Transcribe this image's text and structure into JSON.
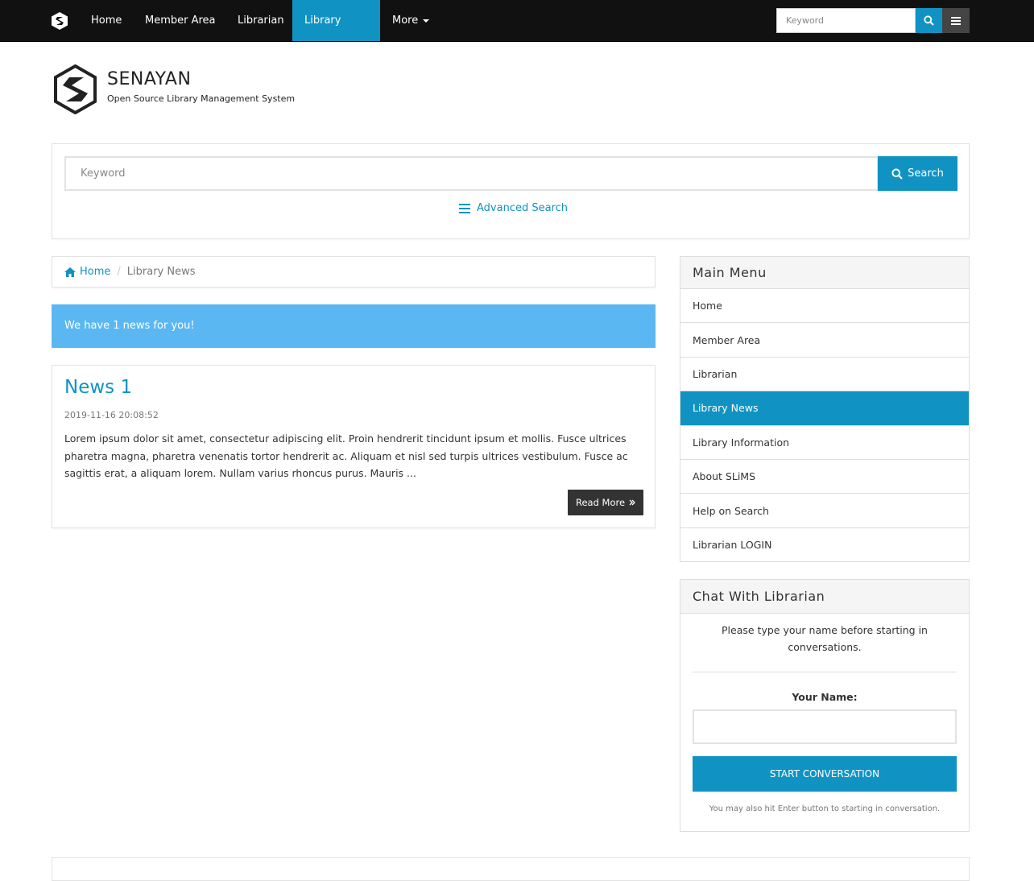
{
  "navbar": {
    "items": [
      "Home",
      "Member Area",
      "Librarian",
      "Library News",
      "More"
    ],
    "search_placeholder": "Keyword"
  },
  "brand": {
    "name": "SENAYAN",
    "tagline": "Open Source Library Management System"
  },
  "search": {
    "placeholder": "Keyword",
    "button": "Search",
    "advanced": "Advanced Search"
  },
  "breadcrumb": {
    "home": "Home",
    "current": "Library News"
  },
  "info": "We have 1 news for you!",
  "news": {
    "title": "News 1",
    "date": "2019-11-16 20:08:52",
    "body": "Lorem ipsum dolor sit amet, consectetur adipiscing elit. Proin hendrerit tincidunt ipsum et mollis. Fusce ultrices pharetra magna, pharetra venenatis tortor hendrerit ac. Aliquam et nisl sed turpis ultrices vestibulum. Fusce ac sagittis erat, a aliquam lorem. Nullam varius rhoncus purus. Mauris ...",
    "read_more": "Read More"
  },
  "main_menu": {
    "title": "Main Menu",
    "items": [
      "Home",
      "Member Area",
      "Librarian",
      "Library News",
      "Library Information",
      "About SLiMS",
      "Help on Search",
      "Librarian LOGIN"
    ]
  },
  "chat": {
    "title": "Chat With Librarian",
    "intro": "Please type your name before starting in conversations.",
    "name_label": "Your Name:",
    "button": "START CONVERSATION",
    "note": "You may also hit Enter button to starting in conversation."
  },
  "colors": {
    "accent": "#1093c3",
    "info_bg": "#5bb7f2",
    "navbar_bg": "#111111"
  }
}
